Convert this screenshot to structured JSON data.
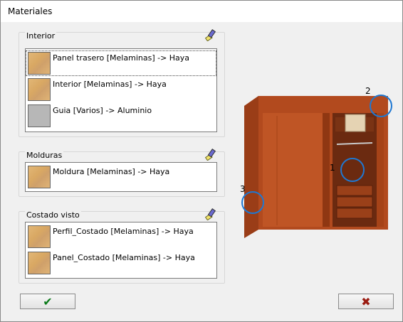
{
  "window": {
    "title": "Materiales"
  },
  "groups": {
    "interior": {
      "label": "Interior",
      "items": [
        {
          "label": "Panel trasero [Melaminas] -> Haya",
          "material": "wood",
          "selected": true
        },
        {
          "label": "Interior [Melaminas] -> Haya",
          "material": "wood"
        },
        {
          "label": "Guia [Varios] -> Aluminio",
          "material": "aluminium"
        }
      ]
    },
    "molduras": {
      "label": "Molduras",
      "items": [
        {
          "label": "Moldura [Melaminas] -> Haya",
          "material": "wood"
        }
      ]
    },
    "costado": {
      "label": "Costado visto",
      "items": [
        {
          "label": "Perfil_Costado [Melaminas] -> Haya",
          "material": "wood"
        },
        {
          "label": "Panel_Costado [Melaminas] -> Haya",
          "material": "wood"
        }
      ]
    }
  },
  "preview": {
    "markers": [
      "1",
      "2",
      "3"
    ]
  },
  "buttons": {
    "ok": "✔",
    "cancel": "✖"
  },
  "colors": {
    "ok": "#0a7a18",
    "cancel": "#9b1c12",
    "marker": "#1e78d2",
    "wood_dark": "#a4451c",
    "wood_light": "#c85c28"
  },
  "icons": [
    "paint-brush-icon",
    "check-icon",
    "close-icon"
  ]
}
